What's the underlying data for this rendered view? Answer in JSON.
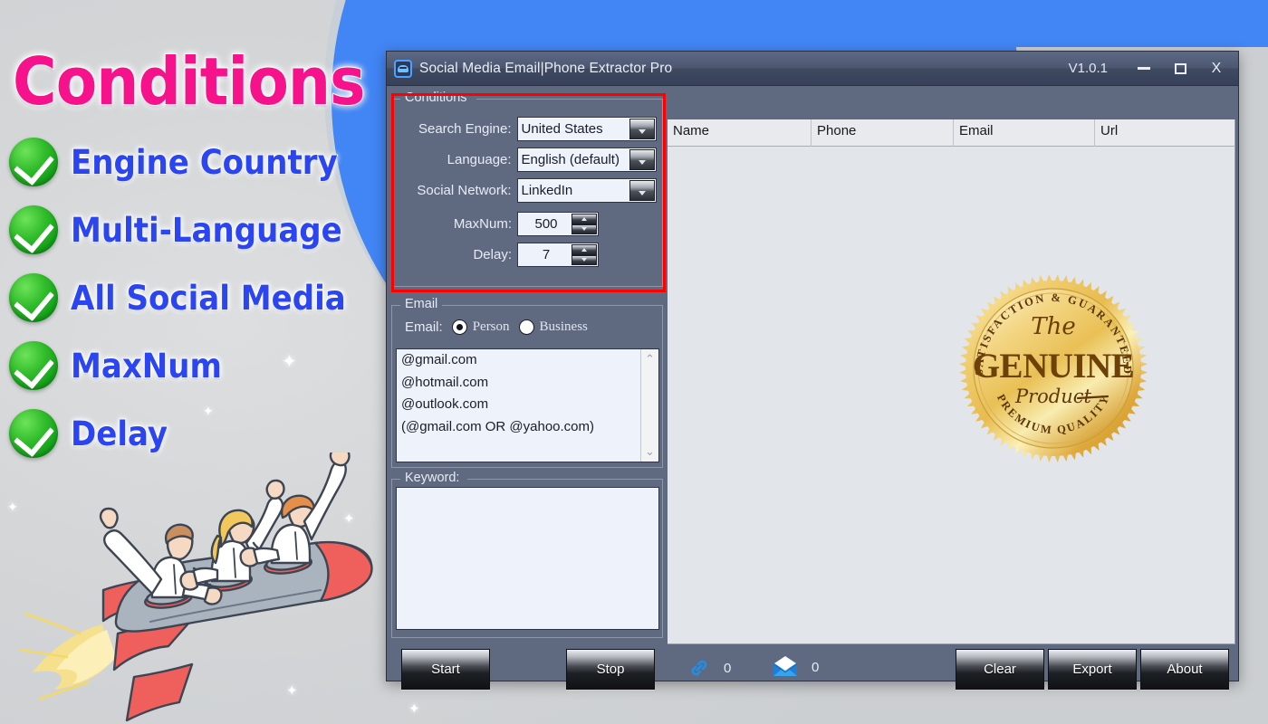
{
  "promo": {
    "title": "Conditions",
    "features": [
      {
        "icon": "green-check-icon",
        "label": "Engine Country"
      },
      {
        "icon": "green-check-icon",
        "label": "Multi-Language"
      },
      {
        "icon": "green-check-icon",
        "label": "All Social Media"
      },
      {
        "icon": "green-check-icon",
        "label": "MaxNum"
      },
      {
        "icon": "green-check-icon",
        "label": "Delay"
      }
    ],
    "title_color": "#f5128b",
    "feature_color": "#2b46f0",
    "check_color": "#13a61a",
    "band_color": "#4285f4"
  },
  "window": {
    "icon": "app-logo-icon",
    "title": "Social Media Email|Phone Extractor Pro",
    "version": "V1.0.1",
    "minimize": "minimize-icon",
    "maximize": "maximize-icon",
    "close": "X"
  },
  "conditions": {
    "legend": "Conditions",
    "highlight_color": "#ff0000",
    "search_engine": {
      "label": "Search Engine:",
      "value": "United States"
    },
    "language": {
      "label": "Language:",
      "value": "English (default)"
    },
    "social_network": {
      "label": "Social Network:",
      "value": "LinkedIn"
    },
    "maxnum": {
      "label": "MaxNum:",
      "value": "500"
    },
    "delay": {
      "label": "Delay:",
      "value": "7"
    }
  },
  "email": {
    "legend": "Email",
    "radio_label": "Email:",
    "options": [
      {
        "label": "Person",
        "selected": true
      },
      {
        "label": "Business",
        "selected": false
      }
    ],
    "domains": [
      "@gmail.com",
      "@hotmail.com",
      "@outlook.com",
      "(@gmail.com OR @yahoo.com)"
    ],
    "scroll_up": "▲",
    "scroll_down": "▼"
  },
  "keyword": {
    "legend": "Keyword:",
    "value": ""
  },
  "actions": {
    "start": "Start",
    "stop": "Stop",
    "clear": "Clear",
    "export": "Export",
    "about": "About"
  },
  "status": {
    "link_icon": "link-icon",
    "link_count": "0",
    "mail_icon": "envelope-icon",
    "mail_count": "0"
  },
  "table": {
    "columns": [
      "Name",
      "Phone",
      "Email",
      "Url"
    ],
    "rows": []
  },
  "badge": {
    "top_text": "SATISFACTION & GUARANTEED",
    "script_top": "The",
    "main_text": "GENUINE",
    "script_bottom": "Product",
    "bottom_text": "PREMIUM QUALITY"
  }
}
